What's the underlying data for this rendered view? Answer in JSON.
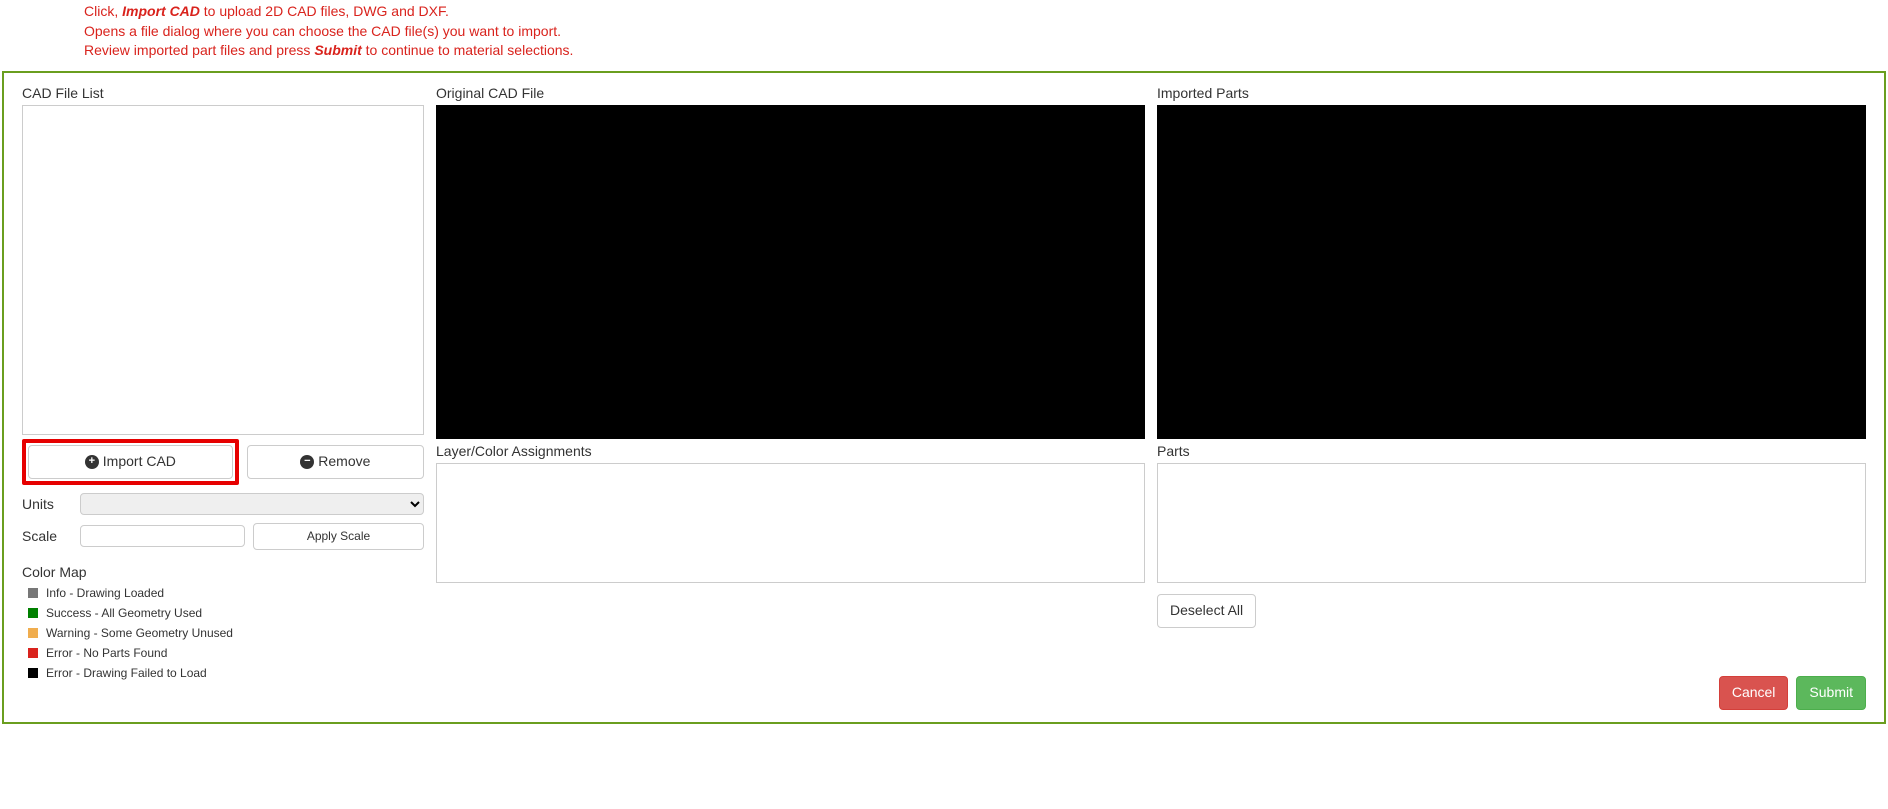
{
  "instructions": {
    "line1_pre": "Click, ",
    "line1_bold": "Import CAD",
    "line1_post": " to upload 2D CAD files, DWG and DXF.",
    "line2": "Opens a file dialog where you can choose the CAD file(s) you want to import.",
    "line3_pre": "Review imported part files and press ",
    "line3_bold": "Submit",
    "line3_post": " to continue to material selections."
  },
  "left": {
    "list_title": "CAD File List",
    "import_btn": "Import CAD",
    "remove_btn": "Remove",
    "units_label": "Units",
    "units_value": "",
    "scale_label": "Scale",
    "scale_value": "",
    "apply_scale_btn": "Apply Scale",
    "color_map_title": "Color Map",
    "legend": {
      "info": "Info - Drawing Loaded",
      "success": "Success - All Geometry Used",
      "warning": "Warning - Some Geometry Unused",
      "error1": "Error - No Parts Found",
      "error2": "Error - Drawing Failed to Load"
    }
  },
  "mid": {
    "viewer_title": "Original CAD File",
    "assignments_title": "Layer/Color Assignments",
    "assignments_value": ""
  },
  "right": {
    "viewer_title": "Imported Parts",
    "parts_title": "Parts",
    "parts_value": "",
    "deselect_btn": "Deselect All"
  },
  "footer": {
    "cancel": "Cancel",
    "submit": "Submit"
  }
}
